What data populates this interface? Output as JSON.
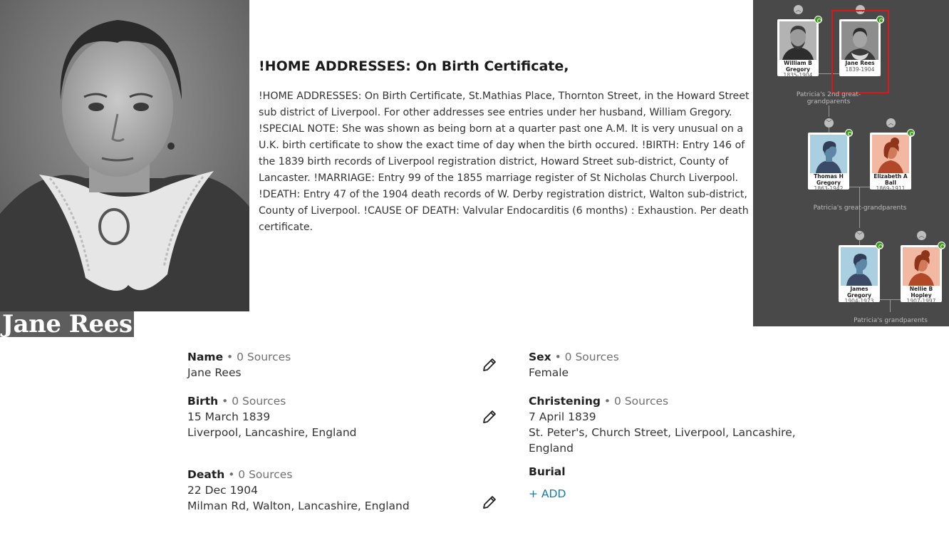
{
  "person": {
    "name_banner": "Jane Rees"
  },
  "notes": {
    "title": "!HOME ADDRESSES: On Birth Certificate,",
    "body": " !HOME ADDRESSES: On Birth Certificate, St.Mathias Place, Thornton Street, in the Howard Street sub district of Liverpool. For other addresses see entries under her husband, William Gregory. !SPECIAL NOTE: She was shown as being born at a quarter past one A.M. It is very unusual on a U.K. birth certificate to show the exact time of day when the birth occured. !BIRTH: Entry 146 of the 1839 birth records of Liverpool registration district, Howard Street sub-district, County of Lancaster. !MARRIAGE: Entry 99 of the 1855 marriage register of St Nicholas Church Liverpool. !DEATH: Entry 47 of the 1904 death records of W. Derby registration district, Walton sub-district, County of Liverpool. !CAUSE OF DEATH: Valvular Endocarditis (6 months) : Exhaustion. Per death certificate."
  },
  "tree": {
    "cards": [
      {
        "name": "William B Gregory",
        "years": "1835-1904",
        "photo": "man-photo"
      },
      {
        "name": "Jane Rees",
        "years": "1839-1904",
        "photo": "woman-photo"
      },
      {
        "name": "Thomas H Gregory",
        "years": "1863-1942",
        "photo": "male-silhouette"
      },
      {
        "name": "Elizabeth A Ball",
        "years": "1869-1911",
        "photo": "female-silhouette"
      },
      {
        "name": "James Gregory",
        "years": "1904-1973",
        "photo": "male-silhouette"
      },
      {
        "name": "Nellie B Hopley",
        "years": "1907-1997",
        "photo": "female-silhouette"
      }
    ],
    "labels": {
      "gen2": "Patricia's 2nd great-grandparents",
      "gen1": "Patricia's great-grandparents",
      "gen0": "Patricia's grandparents"
    },
    "colors": {
      "background": "#494949",
      "highlight": "#e01515",
      "badge": "#3f9b1f",
      "male_bg": "#a9cfe0",
      "female_bg": "#f2b8a2"
    }
  },
  "facts": {
    "name": {
      "label": "Name",
      "sources": " • 0 Sources",
      "value": "Jane Rees"
    },
    "sex": {
      "label": "Sex",
      "sources": " • 0 Sources",
      "value": "Female"
    },
    "birth": {
      "label": "Birth",
      "sources": " • 0 Sources",
      "date": "15 March 1839",
      "place": "Liverpool, Lancashire, England"
    },
    "christening": {
      "label": "Christening",
      "sources": " • 0 Sources",
      "date": "7 April 1839",
      "place": "St. Peter's, Church Street, Liverpool, Lancashire, England"
    },
    "death": {
      "label": "Death",
      "sources": " • 0 Sources",
      "date": "22 Dec 1904",
      "place": "Milman Rd, Walton, Lancashire, England"
    },
    "burial": {
      "label": "Burial",
      "add_label": "+  ADD"
    }
  }
}
